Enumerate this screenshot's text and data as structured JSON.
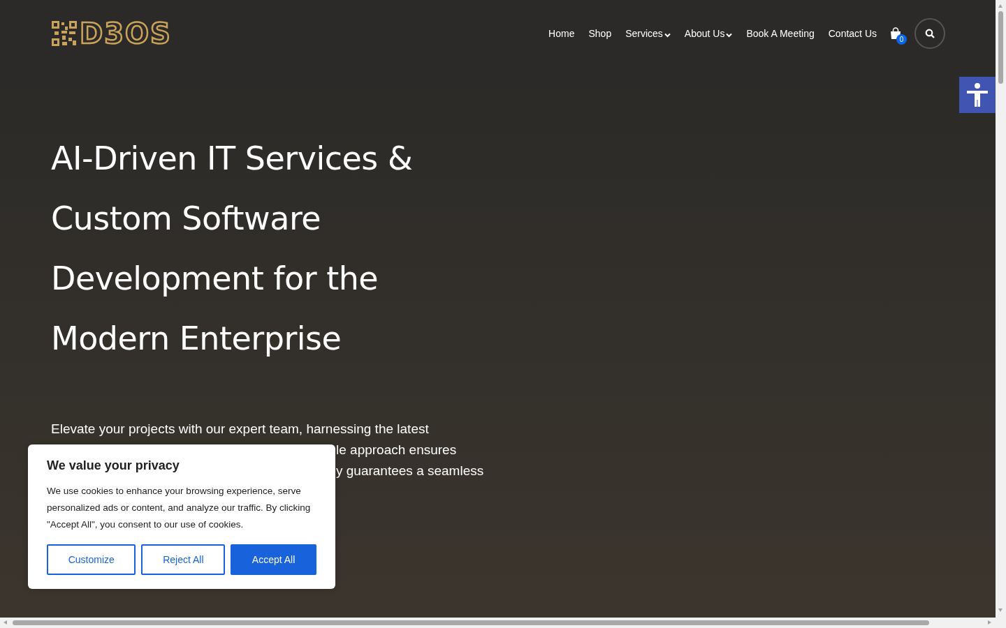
{
  "header": {
    "logo_text": "D3OS",
    "nav": [
      {
        "label": "Home",
        "has_submenu": false
      },
      {
        "label": "Shop",
        "has_submenu": false
      },
      {
        "label": "Services",
        "has_submenu": true
      },
      {
        "label": "About Us",
        "has_submenu": true
      },
      {
        "label": "Book A Meeting",
        "has_submenu": false
      },
      {
        "label": "Contact Us",
        "has_submenu": false
      }
    ],
    "cart_count": "0"
  },
  "hero": {
    "title": "AI-Driven IT Services & Custom Software Development for the Modern Enterprise",
    "paragraph_first_line": "Elevate your projects with our expert team, harnessing the latest",
    "paragraph_fragments_beside_banner": [
      "le approach ensures",
      "y guarantees a seamless"
    ]
  },
  "cookie_banner": {
    "title": "We value your privacy",
    "text": "We use cookies to enhance your browsing experience, serve personalized ads or content, and analyze our traffic. By clicking \"Accept All\", you consent to our use of cookies.",
    "buttons": [
      {
        "label": "Customize",
        "primary": false
      },
      {
        "label": "Reject All",
        "primary": false
      },
      {
        "label": "Accept All",
        "primary": true
      }
    ]
  }
}
